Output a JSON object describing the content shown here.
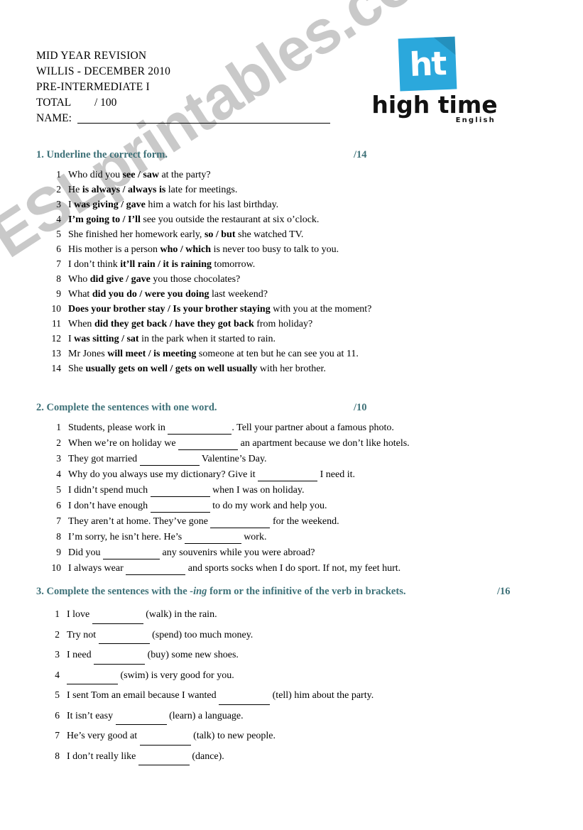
{
  "watermark": {
    "text": "ESLprintables.com"
  },
  "header": {
    "line1": "MID YEAR REVISION",
    "line2": "WILLIS - DECEMBER 2010",
    "line3": "PRE-INTERMEDIATE I",
    "total_label": "TOTAL",
    "total_value": "/ 100",
    "name_label": "NAME:",
    "name_value": ""
  },
  "logo": {
    "mark_text": "ht",
    "wordmark": "high time",
    "subtitle": "English",
    "brand_color": "#2ba8dc"
  },
  "accent_color": "#3e7178",
  "sections": [
    {
      "number": "1.",
      "title": "1. Underline the correct form.",
      "score": "/14",
      "items": [
        {
          "n": "1",
          "pre": "Who did you ",
          "bold": "see / saw",
          "post": " at the party?"
        },
        {
          "n": "2",
          "pre": "He ",
          "bold": "is always / always is",
          "post": " late for meetings."
        },
        {
          "n": "3",
          "pre": "I ",
          "bold": "was giving / gave",
          "post": " him a watch for his last birthday."
        },
        {
          "n": "4",
          "pre": "",
          "bold": "I’m going to / I’ll",
          "post": " see you outside the restaurant at six o’clock."
        },
        {
          "n": "5",
          "pre": "She finished her homework early, ",
          "bold": "so / but",
          "post": " she watched TV."
        },
        {
          "n": "6",
          "pre": "His mother is a person ",
          "bold": "who / which",
          "post": " is never too busy to talk to you."
        },
        {
          "n": "7",
          "pre": "I don’t think ",
          "bold": "it’ll rain / it is raining",
          "post": " tomorrow."
        },
        {
          "n": "8",
          "pre": "Who ",
          "bold": "did give / gave",
          "post": " you those chocolates?"
        },
        {
          "n": "9",
          "pre": "What ",
          "bold": "did you do / were you doing",
          "post": " last weekend?"
        },
        {
          "n": "10",
          "pre": "",
          "bold": "Does your brother stay / Is your brother staying",
          "post": " with you at the moment?"
        },
        {
          "n": "11",
          "pre": "When ",
          "bold": "did they get back / have they got back",
          "post": " from holiday?"
        },
        {
          "n": "12",
          "pre": "I ",
          "bold": "was sitting / sat",
          "post": " in the park when it started to rain."
        },
        {
          "n": "13",
          "pre": "Mr Jones ",
          "bold": "will meet / is meeting",
          "post": " someone at ten but he can see you at 11."
        },
        {
          "n": "14",
          "pre": "She ",
          "bold": "usually gets on well / gets on well usually",
          "post": " with her brother."
        }
      ]
    },
    {
      "number": "2.",
      "title": "2. Complete the sentences with one word.",
      "score": "/10",
      "items": [
        {
          "n": "1",
          "pre": "Students, please work in ",
          "blank": 90,
          "post": ". Tell your partner about a famous photo."
        },
        {
          "n": "2",
          "pre": "When we’re on holiday we ",
          "blank": 84,
          "post": " an apartment because we don’t like hotels."
        },
        {
          "n": "3",
          "pre": "They got married ",
          "blank": 84,
          "post": " Valentine’s Day."
        },
        {
          "n": "4",
          "pre": "Why do you always use my dictionary? Give it ",
          "blank": 84,
          "post": " I need it."
        },
        {
          "n": "5",
          "pre": "I didn’t spend much ",
          "blank": 84,
          "post": " when I was on holiday."
        },
        {
          "n": "6",
          "pre": "I don’t have enough ",
          "blank": 84,
          "post": " to do my work and help you."
        },
        {
          "n": "7",
          "pre": "They aren’t at home. They’ve gone ",
          "blank": 84,
          "post": " for the weekend."
        },
        {
          "n": "8",
          "pre": "I’m sorry, he isn’t here. He’s ",
          "blank": 80,
          "post": " work."
        },
        {
          "n": "9",
          "pre": "Did you ",
          "blank": 80,
          "post": " any souvenirs while you were abroad?"
        },
        {
          "n": "10",
          "pre": "I always wear ",
          "blank": 84,
          "post": " and sports socks when I do sport. If not, my feet hurt."
        }
      ]
    },
    {
      "number": "3.",
      "title_pre": "3. Complete the sentences with the ",
      "title_ing": "-ing",
      "title_post": " form or the infinitive of the verb in brackets.",
      "score": "/16",
      "items": [
        {
          "n": "1",
          "pre": "I love ",
          "blank": 72,
          "post": " (walk) in the rain."
        },
        {
          "n": "2",
          "pre": "Try not ",
          "blank": 72,
          "post": " (spend) too much money."
        },
        {
          "n": "3",
          "pre": "I need ",
          "blank": 72,
          "post": " (buy) some new shoes."
        },
        {
          "n": "4",
          "pre": "",
          "blank": 72,
          "post": " (swim) is very good for you."
        },
        {
          "n": "5",
          "pre": "I sent Tom an email because I wanted ",
          "blank": 72,
          "post": " (tell) him about the party."
        },
        {
          "n": "6",
          "pre": "It isn’t easy ",
          "blank": 72,
          "post": " (learn) a language."
        },
        {
          "n": "7",
          "pre": "He’s very good at ",
          "blank": 72,
          "post": " (talk) to new people."
        },
        {
          "n": "8",
          "pre": "I don’t really like ",
          "blank": 72,
          "post": " (dance)."
        }
      ]
    }
  ]
}
